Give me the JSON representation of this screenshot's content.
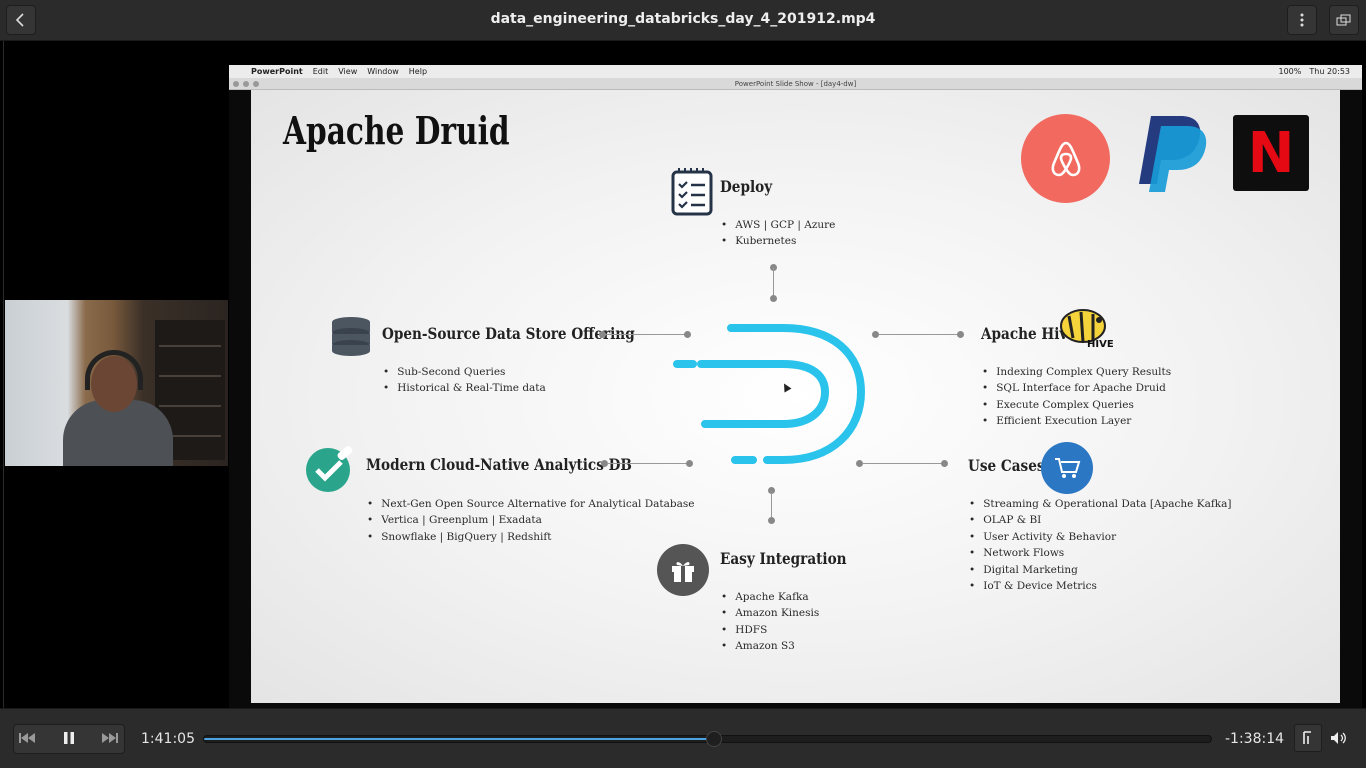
{
  "header": {
    "title": "data_engineering_databricks_day_4_201912.mp4",
    "back_icon": "chevron-left-icon",
    "menu_icon": "kebab-menu-icon",
    "restore_icon": "window-restore-icon"
  },
  "screen": {
    "mac_menu": [
      "",
      "PowerPoint",
      "Edit",
      "View",
      "Window",
      "Help"
    ],
    "mac_status": [
      "100%",
      "Thu 20:53"
    ],
    "window_title": "PowerPoint Slide Show - [day4-dw]"
  },
  "slide": {
    "title": "Apache Druid",
    "deploy": {
      "title": "Deploy",
      "bullets": [
        "AWS | GCP | Azure",
        "Kubernetes"
      ]
    },
    "datastore": {
      "title": "Open-Source Data Store Offering",
      "bullets": [
        "Sub-Second Queries",
        "Historical & Real-Time data"
      ]
    },
    "hive": {
      "title": "Apache Hive",
      "bullets": [
        "Indexing Complex Query Results",
        "SQL Interface for Apache Druid",
        "Execute Complex Queries",
        "Efficient Execution Layer"
      ]
    },
    "modern": {
      "title": "Modern Cloud-Native Analytics DB",
      "bullets": [
        "Next-Gen Open Source Alternative for Analytical Database",
        "Vertica | Greenplum | Exadata",
        "Snowflake | BigQuery | Redshift"
      ]
    },
    "usecases": {
      "title": "Use Cases",
      "bullets": [
        "Streaming & Operational Data [Apache Kafka]",
        "OLAP & BI",
        "User Activity & Behavior",
        "Network Flows",
        "Digital Marketing",
        "IoT & Device Metrics"
      ]
    },
    "integration": {
      "title": "Easy Integration",
      "bullets": [
        "Apache Kafka",
        "Amazon Kinesis",
        "HDFS",
        "Amazon S3"
      ]
    },
    "hive_logo_text": "HIVE",
    "netflix_logo_text": "N"
  },
  "controls": {
    "elapsed": "1:41:05",
    "remaining": "-1:38:14",
    "progress": 0.506,
    "previous_icon": "skip-back-icon",
    "pause_icon": "pause-icon",
    "next_icon": "skip-forward-icon",
    "subtitles_icon": "subtitle-track-icon",
    "volume_icon": "volume-icon"
  },
  "colors": {
    "accent": "#4aa3df",
    "druid": "#29c3ec",
    "airbnb": "#f26a5f",
    "netflix": "#e50914"
  }
}
